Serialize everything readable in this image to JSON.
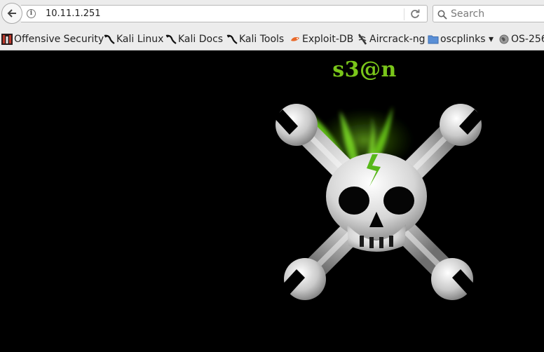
{
  "browser": {
    "url": "10.11.1.251",
    "search_placeholder": "Search"
  },
  "bookmarks": [
    {
      "label": "Offensive Security",
      "icon": "offsec-icon"
    },
    {
      "label": "Kali Linux",
      "icon": "kali-dragon-icon"
    },
    {
      "label": "Kali Docs",
      "icon": "kali-dragon-icon"
    },
    {
      "label": "Kali Tools",
      "icon": "kali-dragon-icon"
    },
    {
      "label": "Exploit-DB",
      "icon": "exploit-db-icon"
    },
    {
      "label": "Aircrack-ng",
      "icon": "aircrack-icon"
    },
    {
      "label": "oscplinks ▾",
      "icon": "folder-icon"
    },
    {
      "label": "OS-256",
      "icon": "globe-icon"
    }
  ],
  "page": {
    "title": "s3@n",
    "image": "skull-crossed-wrenches-image"
  },
  "colors": {
    "page_background": "#000000",
    "title_green": "#7ac61a",
    "toolbar": "#ececec"
  }
}
